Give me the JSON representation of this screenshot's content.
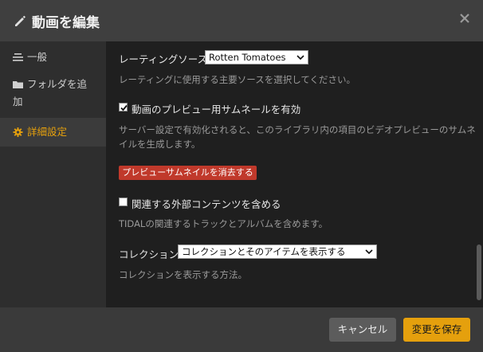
{
  "dialog": {
    "title": "動画を編集",
    "icons": {
      "title": "pencil-icon",
      "close": "close-icon"
    }
  },
  "sidebar": {
    "items": [
      {
        "label": "一般",
        "icon": "list-icon"
      },
      {
        "label": "フォルダを追",
        "label2": "加",
        "icon": "folder-icon"
      },
      {
        "label": "詳細設定",
        "icon": "gear-icon",
        "active": true
      }
    ]
  },
  "main": {
    "rating_source_label": "レーティングソース",
    "rating_source_value": "Rotten Tomatoes",
    "rating_source_help": "レーティングに使用する主要ソースを選択してください。",
    "preview_checkbox_label": "動画のプレビュー用サムネールを有効",
    "preview_checkbox_checked": true,
    "preview_help_1": "サーバー設定で有効化されると、このライブラリ内の項目のビデオプレビューのサムネ",
    "preview_help_2": "イルを生成します。",
    "delete_button": "プレビューサムネイルを消去する",
    "extras_checkbox_label": "関連する外部コンテンツを含める",
    "extras_checkbox_checked": false,
    "extras_help": "TIDALの関連するトラックとアルバムを含めます。",
    "collection_label": "コレクション",
    "collection_value": "コレクションとそのアイテムを表示する",
    "collection_help": "コレクションを表示する方法。"
  },
  "footer": {
    "cancel": "キャンセル",
    "save": "変更を保存"
  },
  "colors": {
    "accent": "#e5a00d",
    "danger": "#c0392b"
  }
}
